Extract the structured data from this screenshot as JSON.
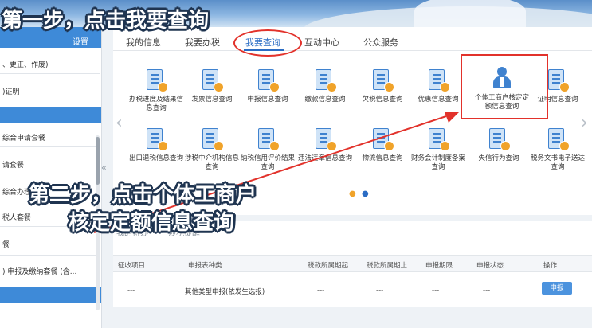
{
  "sidebar": {
    "header_label": "设置",
    "items": [
      {
        "label": "、更正、作废)"
      },
      {
        "label": ")证明"
      },
      {
        "label": "综合申请套餐"
      },
      {
        "label": "请套餐"
      },
      {
        "label": "综合办理"
      },
      {
        "label": "税人套餐"
      },
      {
        "label": "餐"
      },
      {
        "label": ") 申报及缴纳套餐 (含..."
      }
    ]
  },
  "tabs": [
    {
      "label": "我的信息"
    },
    {
      "label": "我要办税"
    },
    {
      "label": "我要查询"
    },
    {
      "label": "互动中心"
    },
    {
      "label": "公众服务"
    }
  ],
  "tiles_row1": [
    {
      "label": "办税进度及结果信息查询",
      "icon": "document-search-icon"
    },
    {
      "label": "发票信息查询",
      "icon": "invoice-icon"
    },
    {
      "label": "申报信息查询",
      "icon": "declaration-icon"
    },
    {
      "label": "缴款信息查询",
      "icon": "payment-icon"
    },
    {
      "label": "欠税信息查询",
      "icon": "arrears-icon"
    },
    {
      "label": "优惠信息查询",
      "icon": "discount-icon"
    },
    {
      "label": "个体工商户核定定额信息查询",
      "icon": "person-icon"
    },
    {
      "label": "证明信息查询",
      "icon": "certificate-icon"
    }
  ],
  "tiles_row2": [
    {
      "label": "出口退税信息查询",
      "icon": "export-icon"
    },
    {
      "label": "涉税中介机构信息查询",
      "icon": "agency-icon"
    },
    {
      "label": "纳税信用评价结果查询",
      "icon": "credit-icon"
    },
    {
      "label": "违法违章信息查询",
      "icon": "violation-icon"
    },
    {
      "label": "物流信息查询",
      "icon": "logistics-icon"
    },
    {
      "label": "财务会计制度备案查询",
      "icon": "accounting-icon"
    },
    {
      "label": "失信行为查询",
      "icon": "dishonest-icon"
    },
    {
      "label": "税务文书电子送达查询",
      "icon": "document-delivery-icon"
    }
  ],
  "section_tabs": [
    "我的待办",
    "涉税提醒"
  ],
  "table": {
    "headers": [
      "征收项目",
      "申报表种类",
      "税款所属期起",
      "税款所属期止",
      "申报期限",
      "申报状态",
      "操作"
    ],
    "row": [
      "---",
      "其他类型申报(依发生选报)",
      "---",
      "---",
      "---",
      "---"
    ],
    "action_label": "申报"
  },
  "annotations": {
    "step1": "第一步，点击我要查询",
    "step2_line1": "第二步，点击个体工商户",
    "step2_line2": "核定定额信息查询"
  },
  "colors": {
    "accent": "#2a6cc4",
    "highlight": "#e2322b",
    "sidebar_bar": "#3e8ad8"
  }
}
